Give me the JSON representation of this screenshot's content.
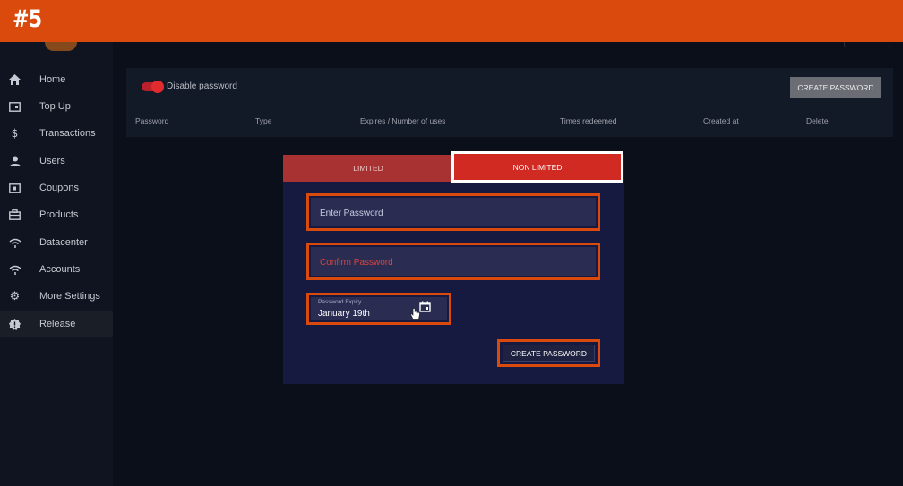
{
  "banner": {
    "label": "#5"
  },
  "sidebar": {
    "items": [
      {
        "label": "Home",
        "icon": "home-icon"
      },
      {
        "label": "Top Up",
        "icon": "wallet-icon"
      },
      {
        "label": "Transactions",
        "icon": "dollar-icon"
      },
      {
        "label": "Users",
        "icon": "user-icon"
      },
      {
        "label": "Coupons",
        "icon": "coupon-icon"
      },
      {
        "label": "Products",
        "icon": "briefcase-icon"
      },
      {
        "label": "Datacenter",
        "icon": "wifi-icon"
      },
      {
        "label": "Accounts",
        "icon": "wifi-icon"
      },
      {
        "label": "More Settings",
        "icon": "gear-icon"
      },
      {
        "label": "Release",
        "icon": "badge-icon"
      }
    ],
    "active": "Release"
  },
  "passwords": {
    "toggle_label": "Disable password",
    "toggle_on": true,
    "create_button": "CREATE PASSWORD",
    "columns": [
      "Password",
      "Type",
      "Expires / Number of uses",
      "Times redeemed",
      "Created at",
      "Delete"
    ]
  },
  "modal": {
    "tabs": [
      {
        "label": "LIMITED",
        "selected": false
      },
      {
        "label": "NON LIMITED",
        "selected": true
      }
    ],
    "password_placeholder": "Enter Password",
    "confirm_placeholder": "Confirm Password",
    "expiry_label": "Password Expiry",
    "expiry_value": "January 19th",
    "submit_label": "CREATE PASSWORD"
  },
  "colors": {
    "banner": "#d94a0c",
    "highlight": "#d94a0c",
    "accent_red": "#d02a22",
    "modal_bg": "#161a40",
    "field_bg": "#2a2c52"
  }
}
